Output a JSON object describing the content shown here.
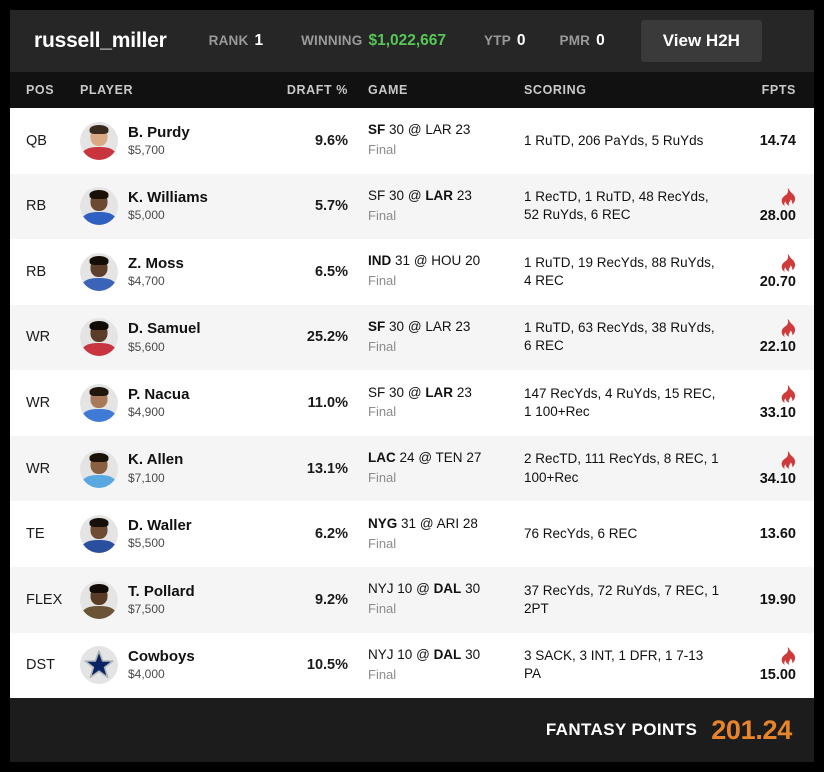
{
  "header": {
    "username": "russell_miller",
    "rank_label": "RANK",
    "rank_value": "1",
    "winning_label": "WINNING",
    "winning_value": "$1,022,667",
    "ytp_label": "YTP",
    "ytp_value": "0",
    "pmr_label": "PMR",
    "pmr_value": "0",
    "h2h_button": "View H2H",
    "money_color": "#56c756"
  },
  "columns": {
    "pos": "POS",
    "player": "PLAYER",
    "draft": "DRAFT %",
    "game": "GAME",
    "scoring": "SCORING",
    "fpts": "FPTS"
  },
  "players": [
    {
      "pos": "QB",
      "name": "B. Purdy",
      "salary": "$5,700",
      "draft_pct": "9.6%",
      "game_away": "SF",
      "game_away_score": "30",
      "game_at": "@",
      "game_home": "LAR",
      "game_home_score": "23",
      "game_bold": "away",
      "game_status": "Final",
      "scoring": "1 RuTD, 206 PaYds, 5 RuYds",
      "fpts": "14.74",
      "hot": false,
      "jersey_color": "#c8353f",
      "skin": "#d9a884",
      "hair": "#3a2a1c"
    },
    {
      "pos": "RB",
      "name": "K. Williams",
      "salary": "$5,000",
      "draft_pct": "5.7%",
      "game_away": "SF",
      "game_away_score": "30",
      "game_at": "@",
      "game_home": "LAR",
      "game_home_score": "23",
      "game_bold": "home",
      "game_status": "Final",
      "scoring": "1 RecTD, 1 RuTD, 48 RecYds, 52 RuYds, 6 REC",
      "fpts": "28.00",
      "hot": true,
      "jersey_color": "#2f5fc0",
      "skin": "#6b4a34",
      "hair": "#191108"
    },
    {
      "pos": "RB",
      "name": "Z. Moss",
      "salary": "$4,700",
      "draft_pct": "6.5%",
      "game_away": "IND",
      "game_away_score": "31",
      "game_at": "@",
      "game_home": "HOU",
      "game_home_score": "20",
      "game_bold": "away",
      "game_status": "Final",
      "scoring": "1 RuTD, 19 RecYds, 88 RuYds, 4 REC",
      "fpts": "20.70",
      "hot": true,
      "jersey_color": "#3a64b8",
      "skin": "#5d3f2b",
      "hair": "#140d06"
    },
    {
      "pos": "WR",
      "name": "D. Samuel",
      "salary": "$5,600",
      "draft_pct": "25.2%",
      "game_away": "SF",
      "game_away_score": "30",
      "game_at": "@",
      "game_home": "LAR",
      "game_home_score": "23",
      "game_bold": "away",
      "game_status": "Final",
      "scoring": "1 RuTD, 63 RecYds, 38 RuYds, 6 REC",
      "fpts": "22.10",
      "hot": true,
      "jersey_color": "#c8353f",
      "skin": "#5a3c28",
      "hair": "#130c06"
    },
    {
      "pos": "WR",
      "name": "P. Nacua",
      "salary": "$4,900",
      "draft_pct": "11.0%",
      "game_away": "SF",
      "game_away_score": "30",
      "game_at": "@",
      "game_home": "LAR",
      "game_home_score": "23",
      "game_bold": "home",
      "game_status": "Final",
      "scoring": "147 RecYds, 4 RuYds, 15 REC, 1 100+Rec",
      "fpts": "33.10",
      "hot": true,
      "jersey_color": "#3f7ad6",
      "skin": "#a9795a",
      "hair": "#20160d"
    },
    {
      "pos": "WR",
      "name": "K. Allen",
      "salary": "$7,100",
      "draft_pct": "13.1%",
      "game_away": "LAC",
      "game_away_score": "24",
      "game_at": "@",
      "game_home": "TEN",
      "game_home_score": "27",
      "game_bold": "away",
      "game_status": "Final",
      "scoring": "2 RecTD, 111 RecYds, 8 REC, 1 100+Rec",
      "fpts": "34.10",
      "hot": true,
      "jersey_color": "#5aa8e0",
      "skin": "#8a6043",
      "hair": "#1a1209"
    },
    {
      "pos": "TE",
      "name": "D. Waller",
      "salary": "$5,500",
      "draft_pct": "6.2%",
      "game_away": "NYG",
      "game_away_score": "31",
      "game_at": "@",
      "game_home": "ARI",
      "game_home_score": "28",
      "game_bold": "away",
      "game_status": "Final",
      "scoring": "76 RecYds, 6 REC",
      "fpts": "13.60",
      "hot": false,
      "jersey_color": "#2a4f9e",
      "skin": "#6d4c33",
      "hair": "#17100a"
    },
    {
      "pos": "FLEX",
      "name": "T. Pollard",
      "salary": "$7,500",
      "draft_pct": "9.2%",
      "game_away": "NYJ",
      "game_away_score": "10",
      "game_at": "@",
      "game_home": "DAL",
      "game_home_score": "30",
      "game_bold": "home",
      "game_status": "Final",
      "scoring": "37 RecYds, 72 RuYds, 7 REC, 1 2PT",
      "fpts": "19.90",
      "hot": false,
      "jersey_color": "#6b5436",
      "skin": "#5a3c26",
      "hair": "#120b05"
    },
    {
      "pos": "DST",
      "name": "Cowboys",
      "salary": "$4,000",
      "draft_pct": "10.5%",
      "game_away": "NYJ",
      "game_away_score": "10",
      "game_at": "@",
      "game_home": "DAL",
      "game_home_score": "30",
      "game_bold": "home",
      "game_status": "Final",
      "scoring": "3 SACK, 3 INT, 1 DFR, 1 7-13 PA",
      "fpts": "15.00",
      "hot": true,
      "is_dst": true,
      "logo": "cowboys-star-logo"
    }
  ],
  "footer": {
    "label": "FANTASY POINTS",
    "total": "201.24",
    "accent_color": "#e8842a"
  },
  "icons": {
    "flame": "flame-icon",
    "hot_color": "#cf3b3b"
  }
}
